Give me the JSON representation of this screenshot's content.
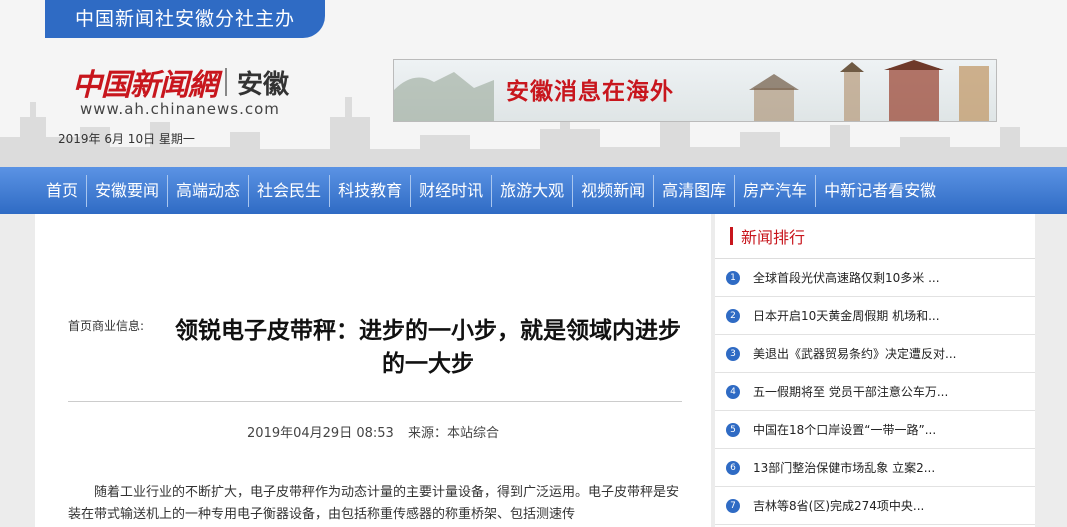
{
  "header": {
    "tab_label": "中国新闻社安徽分社主办",
    "logo_text": "中国新闻網",
    "logo_region": "安徽",
    "site_url": "www.ah.chinanews.com",
    "date": "2019年 6月 10日   星期一",
    "banner_text": "安徽消息在海外"
  },
  "nav": {
    "items": [
      "首页",
      "安徽要闻",
      "高端动态",
      "社会民生",
      "科技教育",
      "财经时讯",
      "旅游大观",
      "视频新闻",
      "高清图库",
      "房产汽车",
      "中新记者看安徽"
    ]
  },
  "article": {
    "breadcrumb": "首页商业信息:",
    "title": "领锐电子皮带秤：进步的一小步，就是领域内进步的一大步",
    "datetime": "2019年04月29日 08:53",
    "source": "来源：本站综合",
    "paragraph": "随着工业行业的不断扩大，电子皮带秤作为动态计量的主要计量设备，得到广泛运用。电子皮带秤是安装在带式输送机上的一种专用电子衡器设备，由包括称重传感器的称重桥架、包括测速传"
  },
  "sidebar": {
    "title": "新闻排行",
    "items": [
      {
        "num": "1",
        "text": "全球首段光伏高速路仅剩10多米 ..."
      },
      {
        "num": "2",
        "text": "日本开启10天黄金周假期 机场和..."
      },
      {
        "num": "3",
        "text": "美退出《武器贸易条约》决定遭反对..."
      },
      {
        "num": "4",
        "text": "五一假期将至 党员干部注意公车万..."
      },
      {
        "num": "5",
        "text": "中国在18个口岸设置“一带一路”..."
      },
      {
        "num": "6",
        "text": "13部门整治保健市场乱象 立案2..."
      },
      {
        "num": "7",
        "text": "吉林等8省(区)完成274项中央..."
      }
    ]
  },
  "colors": {
    "brand_blue": "#2f6bc4",
    "brand_red": "#c8161d"
  }
}
